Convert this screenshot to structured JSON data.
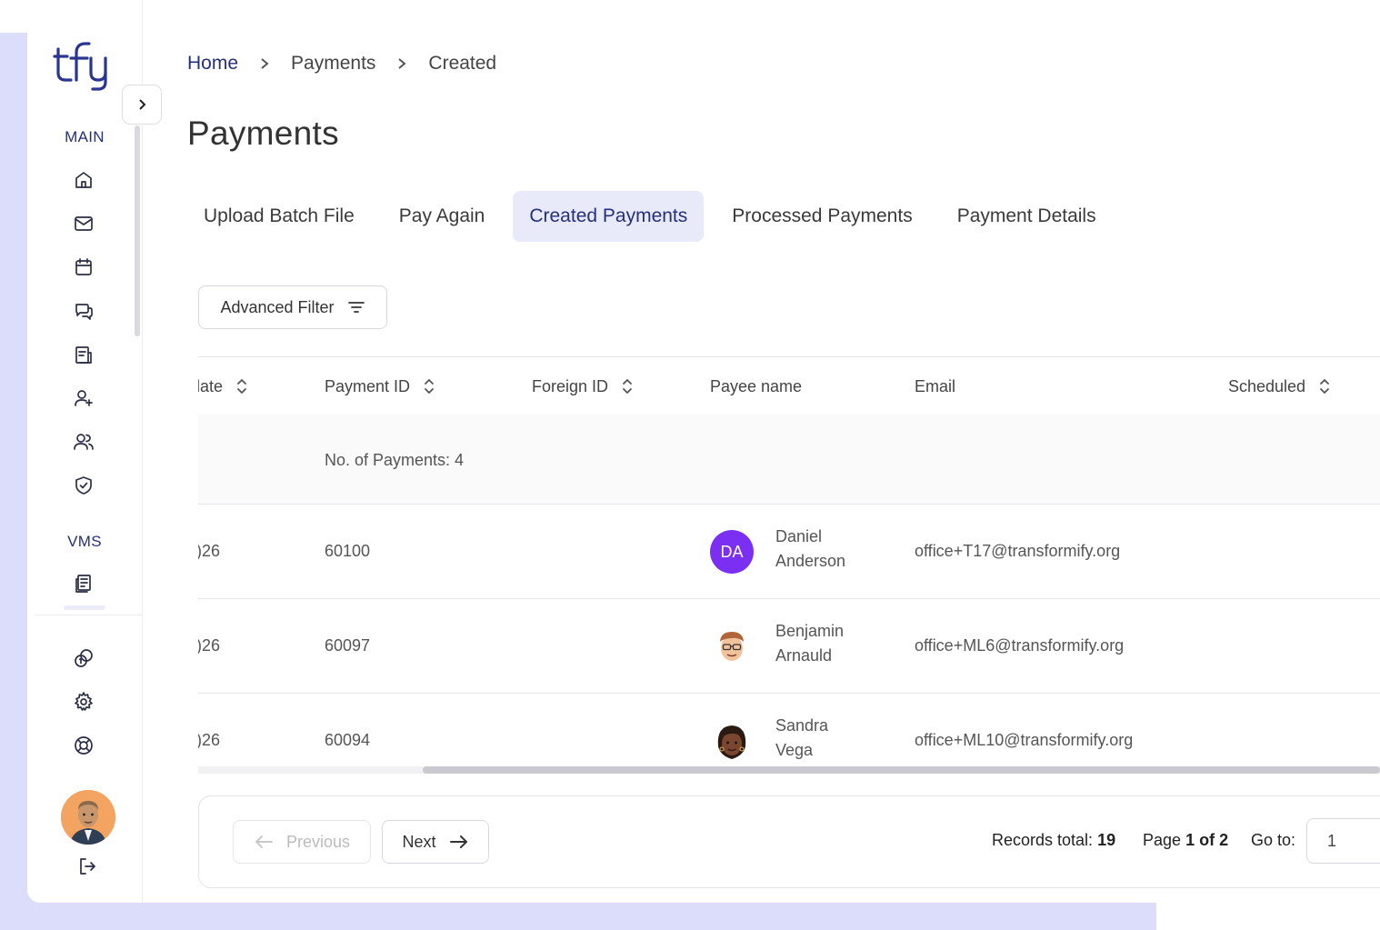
{
  "sidebar": {
    "logo_text": "tfy",
    "main_label": "MAIN",
    "vms_label": "VMS",
    "icons_main": [
      "home-icon",
      "mail-icon",
      "calendar-icon",
      "chat-icon",
      "report-icon",
      "add-user-icon",
      "users-icon",
      "shield-check-icon"
    ],
    "icons_vms": [
      "document-icon"
    ],
    "icons_bottom": [
      "coins-icon",
      "settings-icon",
      "support-icon",
      "logout-icon"
    ]
  },
  "breadcrumb": {
    "home": "Home",
    "payments": "Payments",
    "current": "Created"
  },
  "page": {
    "title": "Payments"
  },
  "tabs": [
    {
      "label": "Upload Batch File",
      "active": false
    },
    {
      "label": "Pay Again",
      "active": false
    },
    {
      "label": "Created Payments",
      "active": true
    },
    {
      "label": "Processed Payments",
      "active": false
    },
    {
      "label": "Payment Details",
      "active": false
    }
  ],
  "filter": {
    "label": "Advanced Filter"
  },
  "table": {
    "columns": {
      "date": "late",
      "payment_id": "Payment ID",
      "foreign_id": "Foreign ID",
      "payee_name": "Payee name",
      "email": "Email",
      "scheduled": "Scheduled"
    },
    "group_label": "No. of Payments: 4",
    "rows": [
      {
        "date": ")26",
        "payment_id": "60100",
        "payee_first": "Daniel",
        "payee_last": "Anderson",
        "initials": "DA",
        "email": "office+T17@transformify.org"
      },
      {
        "date": ")26",
        "payment_id": "60097",
        "payee_first": "Benjamin",
        "payee_last": "Arnauld",
        "initials": "",
        "email": "office+ML6@transformify.org"
      },
      {
        "date": ")26",
        "payment_id": "60094",
        "payee_first": "Sandra",
        "payee_last": "Vega",
        "initials": "",
        "email": "office+ML10@transformify.org"
      }
    ]
  },
  "pagination": {
    "previous": "Previous",
    "next": "Next",
    "records_label": "Records total:",
    "records_total": "19",
    "page_label": "Page",
    "page_of": "1 of 2",
    "goto_label": "Go to:",
    "goto_value": "1"
  },
  "colors": {
    "brand": "#25307a",
    "active_tab_bg": "#e9eaf9",
    "lavender": "#dcdcfb",
    "avatar_purple": "#7b2ff2"
  }
}
